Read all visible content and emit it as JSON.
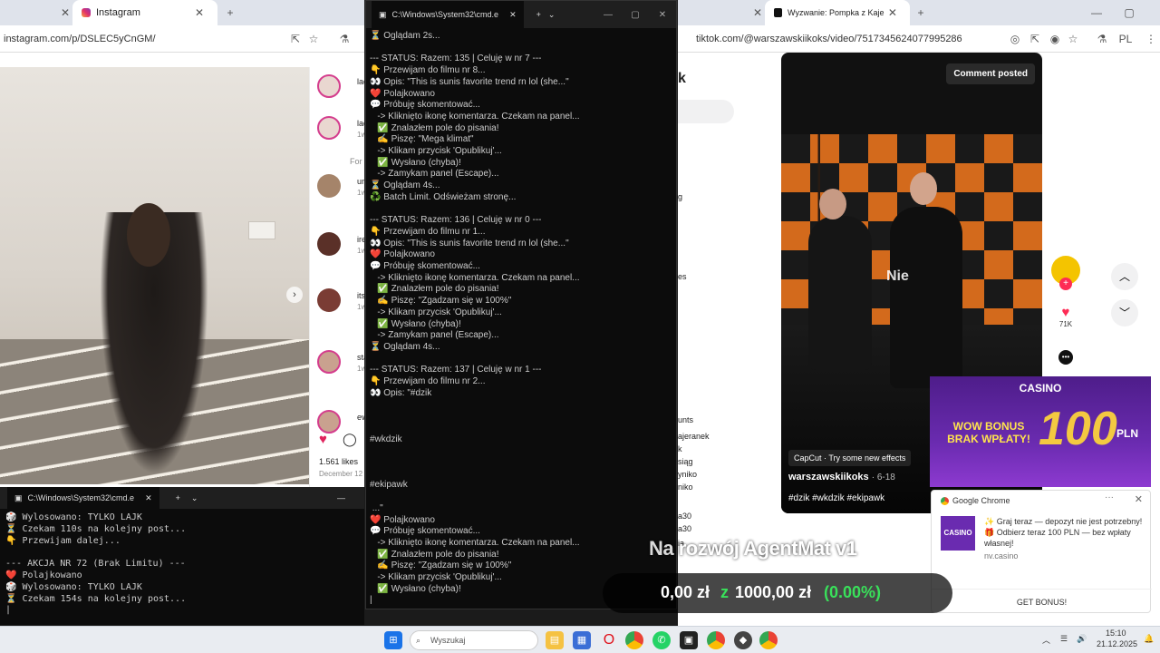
{
  "ig": {
    "tab_title": "Instagram",
    "url": "instagram.com/p/DSLEC5yCnGM/",
    "likes": "1.561 likes",
    "date": "December 12",
    "comments": [
      {
        "name": "lack",
        "sub": ""
      },
      {
        "name": "lack",
        "sub": "1w"
      },
      {
        "name": "For y",
        "sub": ""
      },
      {
        "name": "una",
        "sub": "1w"
      },
      {
        "name": "iren",
        "sub": "1w"
      },
      {
        "name": "itslis",
        "sub": "1w"
      },
      {
        "name": "staa",
        "sub": "1w"
      },
      {
        "name": "ewe",
        "sub": ""
      }
    ]
  },
  "cmd_bottom": {
    "title": "C:\\Windows\\System32\\cmd.e",
    "lines": "🎲 Wylosowano: TYLKO LAJK\n⏳ Czekam 110s na kolejny post...\n👇 Przewijam dalej...\n\n--- AKCJA NR 72 (Brak Limitu) ---\n❤️ Polajkowano\n🎲 Wylosowano: TYLKO LAJK\n⏳ Czekam 154s na kolejny post...\n|"
  },
  "cmd_main": {
    "title": "C:\\Windows\\System32\\cmd.e",
    "lines": "⏳ Oglądam 2s...\n\n--- STATUS: Razem: 135 | Celuję w nr 7 ---\n👇 Przewijam do filmu nr 8...\n👀 Opis: \"This is sunis favorite trend rn lol (she...\"\n❤️ Polajkowano\n💬 Próbuję skomentować...\n   -> Kliknięto ikonę komentarza. Czekam na panel...\n   ✅ Znalazłem pole do pisania!\n   ✍ Piszę: \"Mega klimat\"\n   -> Klikam przycisk 'Opublikuj'...\n   ✅ Wysłano (chyba)!\n   -> Zamykam panel (Escape)...\n⏳ Oglądam 4s...\n♻️ Batch Limit. Odświeżam stronę...\n\n--- STATUS: Razem: 136 | Celuję w nr 0 ---\n👇 Przewijam do filmu nr 1...\n👀 Opis: \"This is sunis favorite trend rn lol (she...\"\n❤️ Polajkowano\n💬 Próbuję skomentować...\n   -> Kliknięto ikonę komentarza. Czekam na panel...\n   ✅ Znalazłem pole do pisania!\n   ✍ Piszę: \"Zgadzam się w 100%\"\n   -> Klikam przycisk 'Opublikuj'...\n   ✅ Wysłano (chyba)!\n   -> Zamykam panel (Escape)...\n⏳ Oglądam 4s...\n\n--- STATUS: Razem: 137 | Celuję w nr 1 ---\n👇 Przewijam do filmu nr 2...\n👀 Opis: \"#dzik\n\n\n\n#wkdzik\n\n\n\n#ekipawk\n\n ...\"\n❤️ Polajkowano\n💬 Próbuję skomentować...\n   -> Kliknięto ikonę komentarza. Czekam na panel...\n   ✅ Znalazłem pole do pisania!\n   ✍ Piszę: \"Zgadzam się w 100%\"\n   -> Klikam przycisk 'Opublikuj'...\n   ✅ Wysłano (chyba)!\n|"
  },
  "tt": {
    "tab_title": "Wyzwanie: Pompka z Kaje",
    "url": "tiktok.com/@warszawskiikoks/video/7517345624077995286",
    "comment_posted": "Comment posted",
    "overlay_word": "Nie",
    "capcut": "CapCut · Try some new effects",
    "author": "warszawskiikoks",
    "author_date": "· 6-18",
    "tags": "#dzik #wkdzik #ekipawk",
    "like_count": "71K",
    "side_letters": [
      "k",
      "g",
      "es",
      "unts",
      "ajeranek",
      "k",
      "siąg",
      "yniko",
      "niko",
      "a30",
      "a30",
      "ia"
    ]
  },
  "casino": {
    "brand": "CASINO",
    "bonus_text": "WOW BONUS BRAK WPŁATY!",
    "amount": "100",
    "currency": "PLN"
  },
  "notification": {
    "app": "Google Chrome",
    "logo": "CASINO",
    "line1": "✨ Graj teraz — depozyt nie jest potrzebny!",
    "line2": "🎁 Odbierz teraz 100 PLN — bez wpłaty własnej!",
    "domain": "nv.casino",
    "button": "GET BONUS!"
  },
  "overlay": {
    "title": "Na rozwój AgentMat v1",
    "current": "0,00 zł",
    "sep": "z",
    "goal": "1000,00 zł",
    "percent": "(0.00%)"
  },
  "taskbar": {
    "search_placeholder": "Wyszukaj",
    "time": "15:10",
    "date": "21.12.2025"
  }
}
